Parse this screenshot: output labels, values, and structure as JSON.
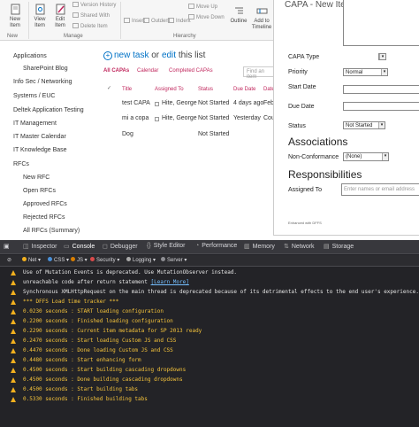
{
  "ribbon": {
    "new_item": "New Item",
    "view_item": "View Item",
    "edit_item": "Edit Item",
    "version_history": "Version History",
    "shared_with": "Shared With",
    "delete_item": "Delete Item",
    "insert": "Insert",
    "outdent": "Outdent",
    "indent": "Indent",
    "move_up": "Move Up",
    "move_down": "Move Down",
    "outline": "Outline",
    "add_to_timeline": "Add to Timeline",
    "group_new": "New",
    "group_manage": "Manage",
    "group_hierarchy": "Hierarchy"
  },
  "nav": {
    "items": [
      "Applications",
      "SharePoint Blog",
      "Info Sec / Networking",
      "Systems / EUC",
      "Deltek Application Testing",
      "IT Management",
      "IT Master Calendar",
      "IT Knowledge Base",
      "RFCs",
      "New RFC",
      "Open RFCs",
      "Approved RFCs",
      "Rejected RFCs",
      "All RFCs (Summary)"
    ]
  },
  "list": {
    "new_task": "new task",
    "or": "or",
    "edit": "edit",
    "this_list": "this list",
    "views": [
      "All CAPAs",
      "Calendar",
      "Completed CAPAs"
    ],
    "find_placeholder": "Find an item",
    "columns": [
      "Title",
      "Assigned To",
      "Status",
      "Due Date",
      "Date"
    ],
    "rows": [
      {
        "title": "test CAPA",
        "assigned": "Hite, George",
        "status": "Not Started",
        "due": "4 days ago",
        "date": "Febr"
      },
      {
        "title": "mi a copa",
        "assigned": "Hite, George",
        "status": "Not Started",
        "due": "Yesterday",
        "date": "Cou"
      },
      {
        "title": "Dog",
        "assigned": "",
        "status": "Not Started",
        "due": "",
        "date": ""
      }
    ]
  },
  "dialog": {
    "title": "CAPA - New Item",
    "capa_type_label": "CAPA Type",
    "priority_label": "Priority",
    "priority_value": "Normal",
    "start_date_label": "Start Date",
    "due_date_label": "Due Date",
    "status_label": "Status",
    "status_value": "Not Started",
    "associations_heading": "Associations",
    "nonconformance_label": "Non-Conformance",
    "nonconformance_value": "(None)",
    "responsibilities_heading": "Responsibilities",
    "assigned_to_label": "Assigned To",
    "assigned_to_placeholder": "Enter names or email address",
    "enhanced_with": "Enhanced with DFFS"
  },
  "devtools": {
    "tabs": [
      "Inspector",
      "Console",
      "Debugger",
      "Style Editor",
      "Performance",
      "Memory",
      "Network",
      "Storage"
    ],
    "active_tab": "Console",
    "filters": [
      "Net",
      "CSS",
      "JS",
      "Security",
      "Logging",
      "Server"
    ],
    "filter_colors": [
      "#f2b01e",
      "#4a90d9",
      "#d97e00",
      "#d94a4a",
      "#aaaaaa",
      "#8e8e93"
    ],
    "warnings": [
      "Use of Mutation Events is deprecated. Use MutationObserver instead.",
      "unreachable code after return statement",
      "Synchronous XMLHttpRequest on the main thread is deprecated because of its detrimental effects to the end user's experience."
    ],
    "learn_more": "[Learn More]",
    "log_lines": [
      "*** DFFS Load time tracker ***",
      "0.0230 seconds : START loading configuration",
      "0.2200 seconds : Finished loading configuration",
      "0.2290 seconds : Current item metadata for SP 2013 ready",
      "0.2470 seconds : Start loading Custom JS and CSS",
      "0.4470 seconds : Done loading Custom JS and CSS",
      "0.4480 seconds : Start enhancing form",
      "0.4500 seconds : Start building cascading dropdowns",
      "0.4500 seconds : Done building cascading dropdowns",
      "0.4500 seconds : Start building tabs",
      "0.5330 seconds : Finished building tabs"
    ],
    "colors": {
      "warning_text": "#e5e5e5",
      "log_text": "#f5c33b",
      "link": "#75bfff"
    }
  }
}
